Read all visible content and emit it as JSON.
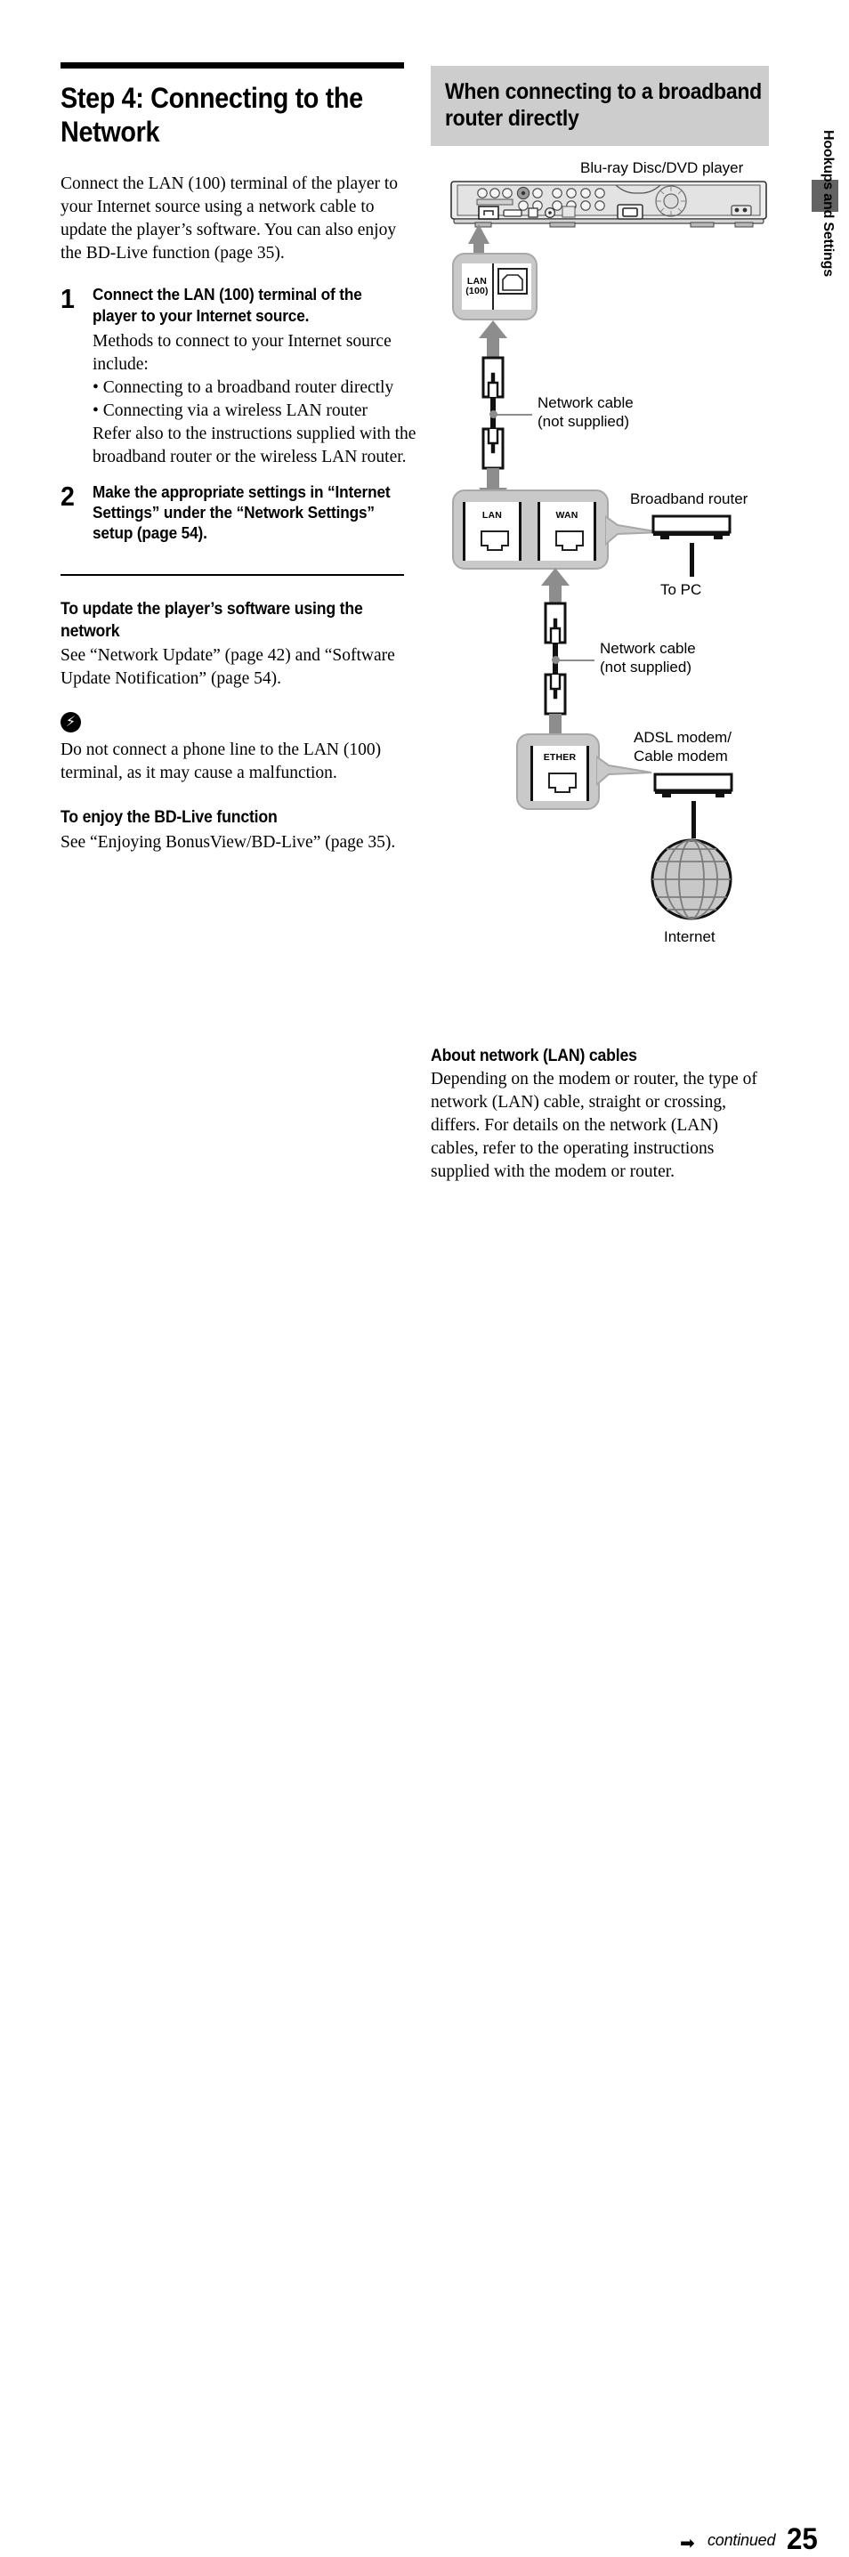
{
  "document": {
    "page_number": "25",
    "continued_label": "continued",
    "continued_arrow": "➡",
    "side_tab_label": "Hookups and Settings"
  },
  "left": {
    "title": "Step 4: Connecting to the Network",
    "intro": "Connect the LAN (100) terminal of the player to your Internet source using a network cable to update the player’s software. You can also enjoy the BD-Live function (page 35).",
    "steps": [
      {
        "number": "1",
        "heading": "Connect the LAN (100) terminal of the player to your Internet source.",
        "lead": "Methods to connect to your Internet source include:",
        "bullets": [
          "• Connecting to a broadband router directly",
          "• Connecting via a wireless LAN router"
        ],
        "tail": "Refer also to the instructions supplied with the broadband router or the wireless LAN router."
      },
      {
        "number": "2",
        "heading": "Make the appropriate settings in “Internet Settings” under the “Network Settings” setup (page 54).",
        "lead": "",
        "bullets": [],
        "tail": ""
      }
    ],
    "sections": [
      {
        "heading": "To update the player’s software using the network",
        "body": "See “Network Update” (page 42) and “Software Update Notification” (page 54)."
      },
      {
        "heading": "",
        "body": "Do not connect a phone line to the LAN (100) terminal, as it may cause a malfunction."
      },
      {
        "heading": "To enjoy the BD-Live function",
        "body": "See “Enjoying BonusView/BD-Live” (page 35)."
      }
    ],
    "note_icon_glyph": "⚡"
  },
  "right": {
    "header": "When connecting to a broadband router directly",
    "diagram": {
      "player_label": "Blu-ray Disc/DVD player",
      "lan_jack_label": "LAN\n(100)",
      "cable_label_top": "Network cable\n(not supplied)",
      "router_lan_label": "LAN",
      "router_wan_label": "WAN",
      "router_label": "Broadband router",
      "to_pc_label": "To PC",
      "cable_label_bottom": "Network cable\n(not supplied)",
      "modem_jack_label": "ETHER",
      "modem_label": "ADSL modem/\nCable modem",
      "internet_label": "Internet"
    },
    "about": {
      "heading": "About network (LAN) cables",
      "body": "Depending on the modem or router, the type of network (LAN) cable, straight or crossing, differs. For details on the network (LAN) cables, refer to the operating instructions supplied with the modem or router."
    }
  },
  "colors": {
    "header_gray": "#cdcdcd",
    "callout_gray": "#c9c9c9",
    "arrow_gray": "#8d8d8d",
    "tab_gray": "#636363"
  }
}
